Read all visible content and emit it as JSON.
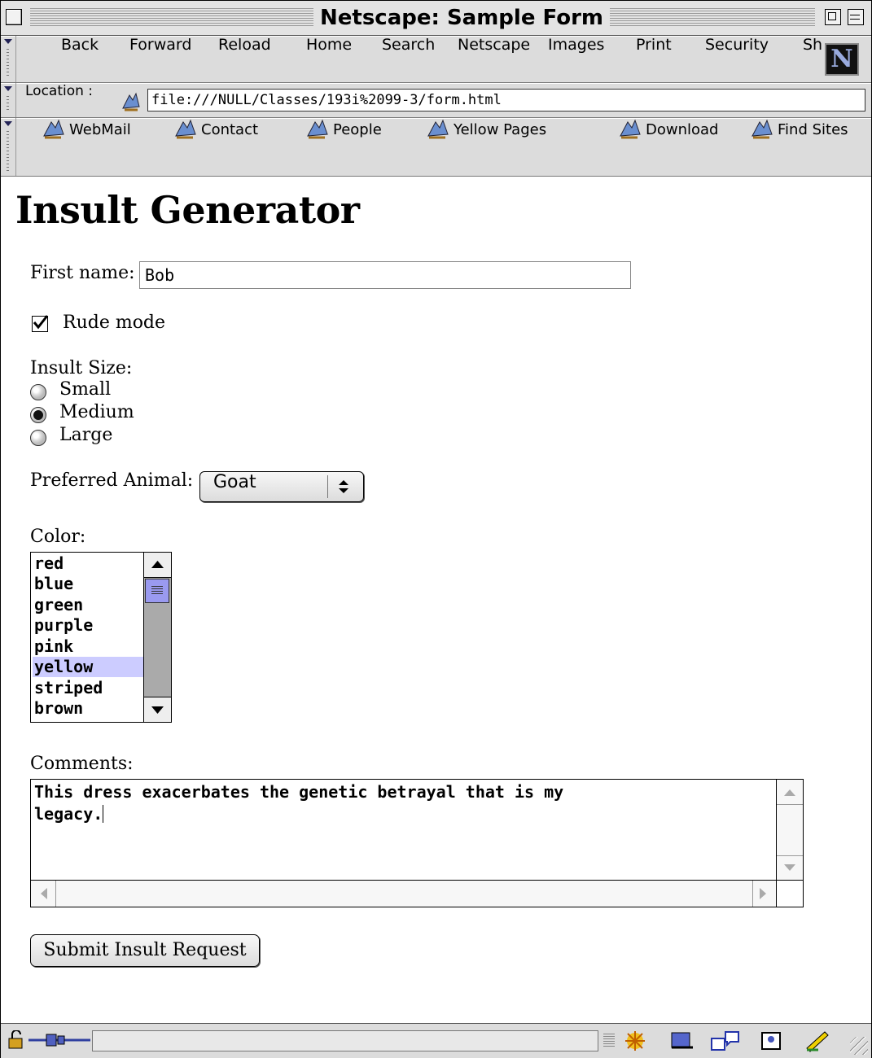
{
  "window": {
    "title": "Netscape: Sample Form"
  },
  "nav_toolbar": {
    "buttons": [
      "Back",
      "Forward",
      "Reload",
      "Home",
      "Search",
      "Netscape",
      "Images",
      "Print",
      "Security",
      "Sh"
    ],
    "logo": "N"
  },
  "location_bar": {
    "label": "Location :",
    "url": "file:///NULL/Classes/193i%2099-3/form.html"
  },
  "bookmarks": [
    "WebMail",
    "Contact",
    "People",
    "Yellow Pages",
    "Download",
    "Find Sites"
  ],
  "page": {
    "heading": "Insult Generator",
    "first_name": {
      "label": "First name:",
      "value": "Bob"
    },
    "rude_mode": {
      "label": "Rude mode",
      "checked": true
    },
    "insult_size": {
      "label": "Insult Size:",
      "options": [
        "Small",
        "Medium",
        "Large"
      ],
      "selected": "Medium"
    },
    "animal": {
      "label": "Preferred Animal:",
      "value": "Goat"
    },
    "color": {
      "label": "Color:",
      "items": [
        "red",
        "blue",
        "green",
        "purple",
        "pink",
        "yellow",
        "striped",
        "brown"
      ],
      "selected": "yellow"
    },
    "comments": {
      "label": "Comments:",
      "value": "This dress exacerbates the genetic betrayal that is my\nlegacy."
    },
    "submit_label": "Submit Insult Request"
  },
  "colors": {
    "selection": "#ccccff",
    "scroll_thumb": "#9a9af0"
  }
}
